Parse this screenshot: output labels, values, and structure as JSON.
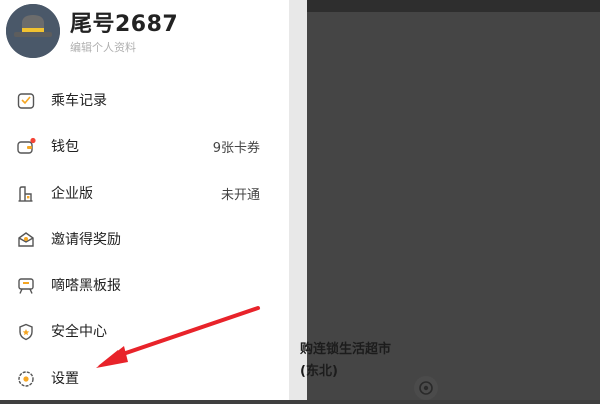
{
  "profile": {
    "name": "尾号2687",
    "edit_label": "编辑个人资料"
  },
  "menu": {
    "items": [
      {
        "label": "乘车记录",
        "value": "",
        "icon": "ride-record-icon"
      },
      {
        "label": "钱包",
        "value": "9张卡券",
        "icon": "wallet-icon",
        "badge": true
      },
      {
        "label": "企业版",
        "value": "未开通",
        "icon": "enterprise-icon"
      },
      {
        "label": "邀请得奖励",
        "value": "",
        "icon": "invite-reward-icon"
      },
      {
        "label": "嘀嗒黑板报",
        "value": "",
        "icon": "blackboard-icon"
      },
      {
        "label": "安全中心",
        "value": "",
        "icon": "security-center-icon"
      },
      {
        "label": "设置",
        "value": "",
        "icon": "settings-icon"
      }
    ]
  },
  "background": {
    "line1": "购连锁生活超市",
    "line2": "(东北)"
  },
  "colors": {
    "accent": "#f5a623",
    "badge": "#f44336",
    "annotation_arrow": "#e8232a",
    "overlay": "#3f3f3f"
  }
}
